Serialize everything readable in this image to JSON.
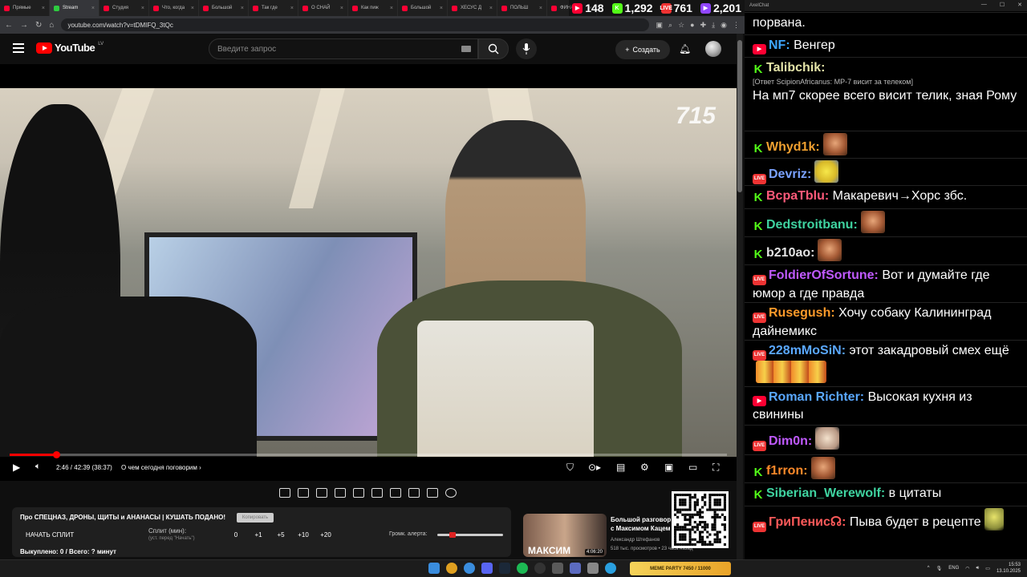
{
  "tabs": [
    {
      "label": "Прямые",
      "icon": "youtube-icon"
    },
    {
      "label": "Stream",
      "icon": "kick-icon"
    },
    {
      "label": "Студия",
      "icon": "youtube-icon"
    },
    {
      "label": "Что, когда",
      "icon": "youtube-icon"
    },
    {
      "label": "Большой",
      "icon": "youtube-icon"
    },
    {
      "label": "Так где",
      "icon": "youtube-icon"
    },
    {
      "label": "О СНАЙ",
      "icon": "youtube-icon"
    },
    {
      "label": "Как пиж",
      "icon": "youtube-icon"
    },
    {
      "label": "Большой",
      "icon": "youtube-icon"
    },
    {
      "label": "ХЕСУС Д",
      "icon": "youtube-icon"
    },
    {
      "label": "ПОЛЬШ",
      "icon": "youtube-icon"
    },
    {
      "label": "ФИНАЛ",
      "icon": "youtube-icon"
    }
  ],
  "counters": [
    {
      "platform": "youtube",
      "value": "148",
      "color": "#ff0033"
    },
    {
      "platform": "kick",
      "value": "1,292",
      "color": "#53fc18"
    },
    {
      "platform": "vk-live",
      "value": "761",
      "color": "#e33"
    },
    {
      "platform": "twitch",
      "value": "2,201",
      "color": "#9146ff"
    }
  ],
  "browser": {
    "url": "youtube.com/watch?v=tDMIFQ_3tQc"
  },
  "youtube": {
    "logo": "YouTube",
    "region": "LV",
    "search_placeholder": "Введите запрос",
    "create_label": "Создать"
  },
  "video": {
    "watermark": "715",
    "time": "2:46 / 42:39 (38:37)",
    "chapter": "О чем сегодня поговорим",
    "progress": 0.065
  },
  "panel": {
    "title": "Про СПЕЦНАЗ, ДРОНЫ, ЩИТЫ и АНАНАСЫ | КУШАТЬ ПОДАНО!",
    "badge": "Копировать",
    "start_split": "НАЧАТЬ СПЛИТ",
    "split_label": "Сплит (мин):",
    "split_sub": "(уст. перед \"Начать\")",
    "split_values": [
      "0",
      "+1",
      "+5",
      "+10",
      "+20"
    ],
    "alert_label": "Громк. алерта:",
    "alert_level": 0.2,
    "bought": "Выкуплено: 0 / Всего: ? минут"
  },
  "recommendation": {
    "title": "Большой разговор с Максимом Кацем",
    "channel": "Александр Штефанов",
    "meta": "518 тыс. просмотров • 23 часа назад",
    "thumb_text": "МАКСИМ",
    "duration": "4:06:20"
  },
  "chat": {
    "window_title": "AxelChat",
    "messages": [
      {
        "platform": "none",
        "nick": "",
        "text": "порвана.",
        "nick_color": "#fff"
      },
      {
        "platform": "yt",
        "nick": "NF:",
        "text": " Венгер",
        "nick_color": "#3ea6ff"
      },
      {
        "platform": "kk",
        "nick": "Talibchik:",
        "reply": "[Ответ ScipionAfricanus: MP-7 висит за телеком]",
        "text": "На мп7 скорее всего висит телик, зная Рому",
        "nick_color": "#e4e4a8"
      },
      {
        "platform": "kk",
        "nick": "Whyd1k:",
        "text": "",
        "emote": "face",
        "nick_color": "#f0a030"
      },
      {
        "platform": "vk",
        "nick": "Devriz:",
        "text": "",
        "emote": "y",
        "nick_color": "#7aa2ff"
      },
      {
        "platform": "kk",
        "nick": "BcpaTblu:",
        "text": " Макаревич→Хорс збс.",
        "nick_color": "#ff5a7a"
      },
      {
        "platform": "kk",
        "nick": "Dedstroitbanu:",
        "text": "",
        "emote": "face",
        "nick_color": "#3fd3a0"
      },
      {
        "platform": "kk",
        "nick": "b210ao:",
        "text": "",
        "emote": "face",
        "nick_color": "#e4e4e4"
      },
      {
        "platform": "vk",
        "nick": "FoldierOfSortune:",
        "text": " Вот и думайте где юмор а где правда",
        "nick_color": "#c05aff"
      },
      {
        "platform": "vk",
        "nick": "Rusegush:",
        "text": " Хочу собаку Калининград дайнемикс",
        "nick_color": "#ff9a2a"
      },
      {
        "platform": "vk",
        "nick": "228mMoSiN:",
        "text": " этот закадровый смех ещё",
        "emote": "m",
        "nick_color": "#5aa8ff"
      },
      {
        "platform": "yt",
        "nick": "Roman Richter:",
        "text": " Высокая кухня из свинины",
        "nick_color": "#5aa8ff"
      },
      {
        "platform": "vk",
        "nick": "Dim0n:",
        "text": "",
        "emote": "s",
        "nick_color": "#c05aff"
      },
      {
        "platform": "kk",
        "nick": "f1rron:",
        "text": "",
        "emote": "face",
        "nick_color": "#ff8a2a"
      },
      {
        "platform": "kk",
        "nick": "Siberian_Werewolf:",
        "text": " в цитаты",
        "nick_color": "#3fd3a0"
      },
      {
        "platform": "vk",
        "nick": "ГриПенис☊:",
        "text": " Пыва будет в рецепте",
        "emote": "g",
        "nick_color": "#ff5a5a"
      }
    ]
  },
  "taskbar": {
    "widget_label": "MEME PARTY 7450 / 11000",
    "lang": "ENG",
    "time": "15:53",
    "date": "13.10.2025"
  }
}
